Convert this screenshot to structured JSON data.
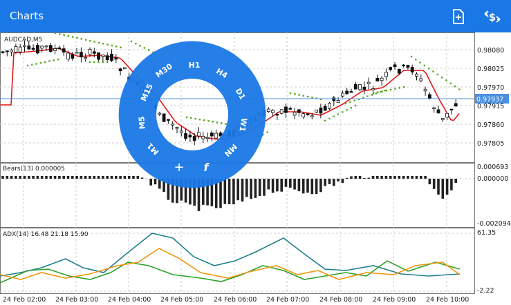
{
  "app": {
    "title": "Charts"
  },
  "toolbar": {
    "add_icon": "new-document-icon",
    "trade_icon": "dollar-exchange-icon"
  },
  "colors": {
    "accent": "#1a78e6",
    "ma": "#e31717",
    "sar": "#55a51d",
    "adx_main": "#1d7f8c",
    "di_plus": "#2ba028",
    "di_minus": "#f0960f",
    "price_line": "#4a90e2"
  },
  "main_chart": {
    "symbol_label": "AUDCAD,M5",
    "price_levels": [
      "0.98080",
      "0.98025",
      "0.97970",
      "0.97915",
      "0.97860",
      "0.97805"
    ],
    "current_price": "0.97937"
  },
  "bears_panel": {
    "label": "Bears(13) 0.000005",
    "levels": [
      "0.000693",
      "0.000000",
      "-0.002094"
    ]
  },
  "adx_panel": {
    "label": "ADX(14) 16.48 21.18 15.90",
    "levels": [
      "61.35",
      "-2.22"
    ]
  },
  "time_axis": [
    "24 Feb 02:00",
    "24 Feb 03:00",
    "24 Feb 04:00",
    "24 Feb 05:00",
    "24 Feb 06:00",
    "24 Feb 07:00",
    "24 Feb 08:00",
    "24 Feb 09:00",
    "24 Feb 10:00"
  ],
  "timeframe_wheel": {
    "items": [
      "H1",
      "H4",
      "D1",
      "W1",
      "MN",
      "M1",
      "M5",
      "M15",
      "M30"
    ],
    "add_label": "+",
    "function_label": "f"
  }
}
